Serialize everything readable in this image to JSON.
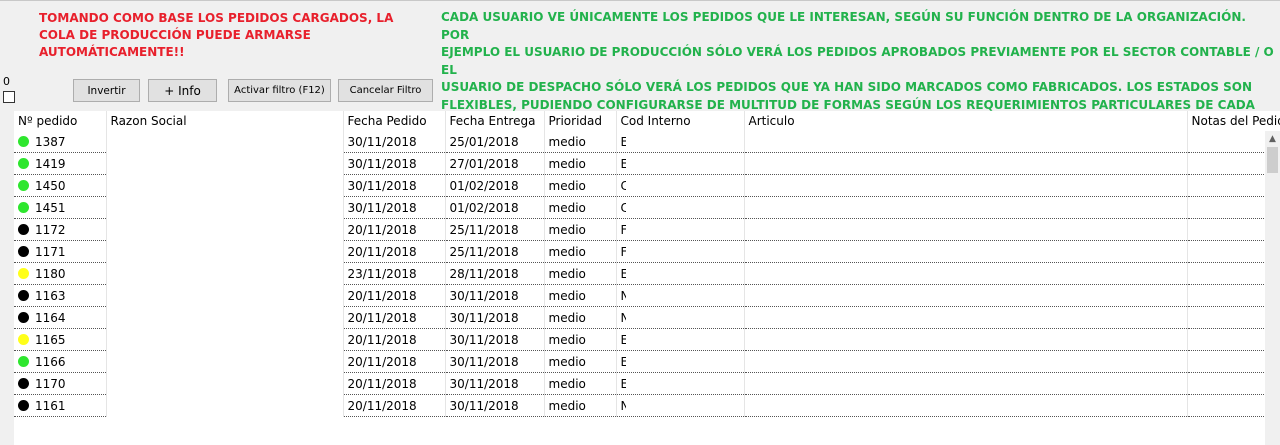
{
  "notes": {
    "red": "TOMANDO COMO BASE LOS PEDIDOS CARGADOS, LA\nCOLA DE PRODUCCIÓN PUEDE ARMARSE\nAUTOMÁTICAMENTE!!",
    "green": "CADA USUARIO VE ÚNICAMENTE LOS PEDIDOS QUE LE INTERESAN, SEGÚN SU FUNCIÓN DENTRO DE LA ORGANIZACIÓN. POR\nEJEMPLO EL USUARIO DE PRODUCCIÓN SÓLO VERÁ LOS PEDIDOS APROBADOS PREVIAMENTE POR EL SECTOR CONTABLE / O EL\nUSUARIO DE DESPACHO SÓLO VERÁ LOS PEDIDOS QUE YA HAN SIDO MARCADOS COMO FABRICADOS. LOS ESTADOS SON\nFLEXIBLES, PUDIENDO CONFIGURARSE DE MULTITUD DE FORMAS SEGÚN LOS REQUERIMIENTOS PARTICULARES DE CADA\nORGANIZACIÓN"
  },
  "selection_count": "0",
  "toolbar": {
    "invertir": "Invertir",
    "info": "+ Info",
    "activar_filtro": "Activar filtro (F12)",
    "cancelar_filtro": "Cancelar Filtro"
  },
  "colors": {
    "green": "#2ee62e",
    "black": "#000000",
    "yellow": "#ffff1a"
  },
  "grid": {
    "columns": [
      "Nº pedido",
      "Razon Social",
      "Fecha Pedido",
      "Fecha Entrega",
      "Prioridad",
      "Cod Interno",
      "Articulo",
      "Notas del Pedido"
    ],
    "rows": [
      {
        "status": "green",
        "num": "1387",
        "fecha_pedido": "30/11/2018",
        "fecha_entrega": "25/01/2018",
        "prioridad": "medio",
        "cod": "E"
      },
      {
        "status": "green",
        "num": "1419",
        "fecha_pedido": "30/11/2018",
        "fecha_entrega": "27/01/2018",
        "prioridad": "medio",
        "cod": "E"
      },
      {
        "status": "green",
        "num": "1450",
        "fecha_pedido": "30/11/2018",
        "fecha_entrega": "01/02/2018",
        "prioridad": "medio",
        "cod": "C"
      },
      {
        "status": "green",
        "num": "1451",
        "fecha_pedido": "30/11/2018",
        "fecha_entrega": "01/02/2018",
        "prioridad": "medio",
        "cod": "C"
      },
      {
        "status": "black",
        "num": "1172",
        "fecha_pedido": "20/11/2018",
        "fecha_entrega": "25/11/2018",
        "prioridad": "medio",
        "cod": "F"
      },
      {
        "status": "black",
        "num": "1171",
        "fecha_pedido": "20/11/2018",
        "fecha_entrega": "25/11/2018",
        "prioridad": "medio",
        "cod": "F"
      },
      {
        "status": "yellow",
        "num": "1180",
        "fecha_pedido": "23/11/2018",
        "fecha_entrega": "28/11/2018",
        "prioridad": "medio",
        "cod": "E"
      },
      {
        "status": "black",
        "num": "1163",
        "fecha_pedido": "20/11/2018",
        "fecha_entrega": "30/11/2018",
        "prioridad": "medio",
        "cod": "N"
      },
      {
        "status": "black",
        "num": "1164",
        "fecha_pedido": "20/11/2018",
        "fecha_entrega": "30/11/2018",
        "prioridad": "medio",
        "cod": "N"
      },
      {
        "status": "yellow",
        "num": "1165",
        "fecha_pedido": "20/11/2018",
        "fecha_entrega": "30/11/2018",
        "prioridad": "medio",
        "cod": "E"
      },
      {
        "status": "green",
        "num": "1166",
        "fecha_pedido": "20/11/2018",
        "fecha_entrega": "30/11/2018",
        "prioridad": "medio",
        "cod": "E"
      },
      {
        "status": "black",
        "num": "1170",
        "fecha_pedido": "20/11/2018",
        "fecha_entrega": "30/11/2018",
        "prioridad": "medio",
        "cod": "E"
      },
      {
        "status": "black",
        "num": "1161",
        "fecha_pedido": "20/11/2018",
        "fecha_entrega": "30/11/2018",
        "prioridad": "medio",
        "cod": "N"
      }
    ]
  },
  "scrollbar": {
    "up_icon": "chevron-up-icon"
  }
}
